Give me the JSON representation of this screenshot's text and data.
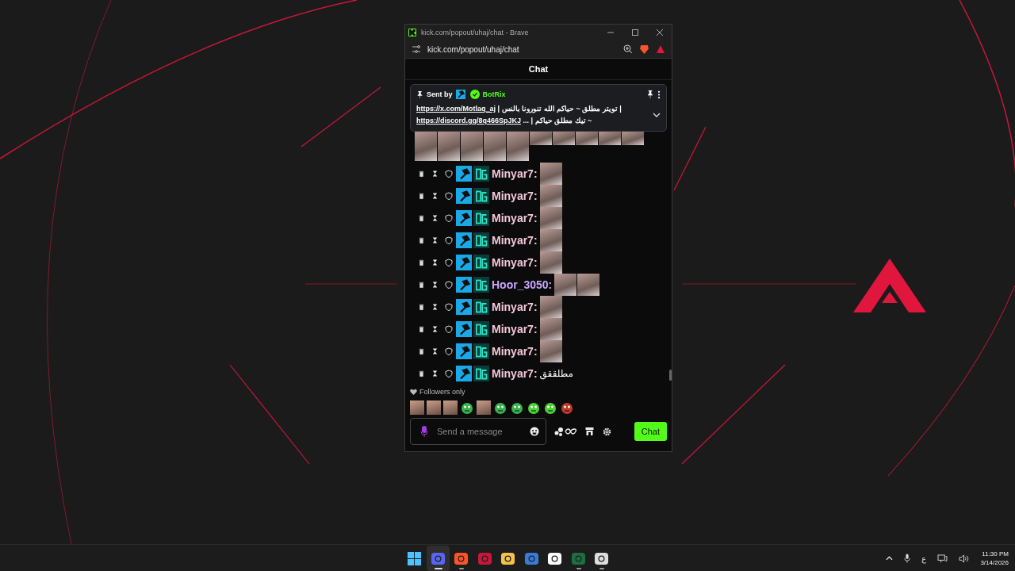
{
  "window": {
    "title": "kick.com/popout/uhaj/chat - Brave",
    "address": "kick.com/popout/uhaj/chat"
  },
  "header": {
    "title": "Chat"
  },
  "pinned": {
    "label": "Sent by",
    "author": "BotRix",
    "lines": [
      {
        "link": "https://x.com/Motlaq_aj",
        "text": "| تويتر مطلق ~ حياكم الله تنورونا بالنس |"
      },
      {
        "link": "https://discord.gg/8q466SpJKJ",
        "text": "~ تيك مطلق حياكم | ..."
      }
    ]
  },
  "messages": [
    {
      "kind": "emotes",
      "emotes": [
        {
          "kind": "tall"
        },
        {
          "kind": "tall"
        },
        {
          "kind": "tall"
        },
        {
          "kind": "tall"
        },
        {
          "kind": "tall"
        },
        {
          "kind": "short"
        },
        {
          "kind": "short"
        },
        {
          "kind": "short"
        },
        {
          "kind": "short"
        },
        {
          "kind": "short"
        }
      ]
    },
    {
      "kind": "chat",
      "username": "Minyar7:",
      "color": "#f4c7da",
      "emotes": [
        {
          "kind": "square"
        }
      ]
    },
    {
      "kind": "chat",
      "username": "Minyar7:",
      "color": "#f4c7da",
      "emotes": [
        {
          "kind": "square"
        }
      ]
    },
    {
      "kind": "chat",
      "username": "Minyar7:",
      "color": "#f4c7da",
      "emotes": [
        {
          "kind": "square"
        }
      ]
    },
    {
      "kind": "chat",
      "username": "Minyar7:",
      "color": "#f4c7da",
      "emotes": [
        {
          "kind": "square"
        }
      ]
    },
    {
      "kind": "chat",
      "username": "Minyar7:",
      "color": "#f4c7da",
      "emotes": [
        {
          "kind": "square"
        }
      ]
    },
    {
      "kind": "chat",
      "username": "Hoor_3050:",
      "color": "#c9a7ff",
      "emotes": [
        {
          "kind": "square"
        },
        {
          "kind": "square"
        }
      ]
    },
    {
      "kind": "chat",
      "username": "Minyar7:",
      "color": "#f4c7da",
      "emotes": [
        {
          "kind": "square"
        }
      ]
    },
    {
      "kind": "chat",
      "username": "Minyar7:",
      "color": "#f4c7da",
      "emotes": [
        {
          "kind": "square"
        }
      ]
    },
    {
      "kind": "chat",
      "username": "Minyar7:",
      "color": "#f4c7da",
      "emotes": [
        {
          "kind": "square"
        }
      ]
    },
    {
      "kind": "chat",
      "username": "Minyar7:",
      "color": "#f4c7da",
      "text": "مطلققق"
    }
  ],
  "mode": {
    "label": "Followers only"
  },
  "emote_bar": [
    {
      "kind": "photo"
    },
    {
      "kind": "photo"
    },
    {
      "kind": "photo"
    },
    {
      "kind": "frog"
    },
    {
      "kind": "photo"
    },
    {
      "kind": "frog"
    },
    {
      "kind": "frog"
    },
    {
      "kind": "blob"
    },
    {
      "kind": "blob"
    },
    {
      "kind": "angry"
    }
  ],
  "composer": {
    "placeholder": "Send a message",
    "send": "Chat"
  },
  "taskbar": {
    "apps": [
      {
        "kind": "start",
        "running": false,
        "selected": false
      },
      {
        "kind": "discord",
        "running": true,
        "selected": true
      },
      {
        "kind": "brave",
        "running": true,
        "selected": false
      },
      {
        "kind": "letter",
        "running": false,
        "selected": false
      },
      {
        "kind": "folder",
        "running": false,
        "selected": false
      },
      {
        "kind": "remote",
        "running": false,
        "selected": false
      },
      {
        "kind": "camera",
        "running": false,
        "selected": false
      },
      {
        "kind": "excel",
        "running": true,
        "selected": false
      },
      {
        "kind": "obs",
        "running": true,
        "selected": false
      }
    ],
    "language": "ع",
    "time": "11:30 PM",
    "date": "3/14/2026"
  }
}
